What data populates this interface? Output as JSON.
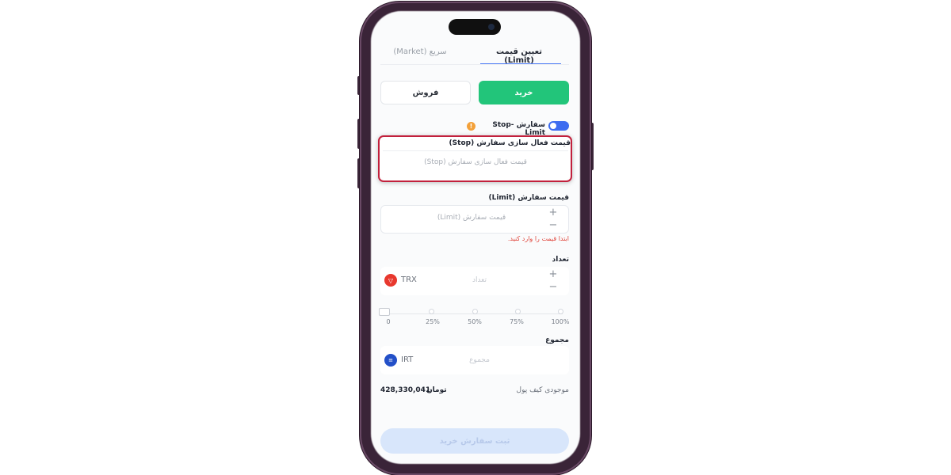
{
  "tabs": {
    "limit_label": "تعیین قیمت (Limit)",
    "market_label": "سریع (Market)"
  },
  "actions": {
    "buy_label": "خرید",
    "sell_label": "فروش"
  },
  "stop_limit": {
    "label": "سفارش Stop-Limit",
    "enabled": true,
    "info_icon": "info-icon"
  },
  "stop_price": {
    "label": "قیمت فعال سازی سفارش (Stop)",
    "placeholder": "(Stop) قیمت فعال سازی سفارش"
  },
  "limit_price": {
    "label": "قیمت سفارش (Limit)",
    "placeholder": "قیمت سفارش (Limit)",
    "error": "ابتدا قیمت را وارد کنید."
  },
  "quantity": {
    "label": "تعداد",
    "placeholder": "تعداد",
    "coin": "TRX"
  },
  "slider": {
    "ticks": [
      "0",
      "25%",
      "50%",
      "75%",
      "100%"
    ],
    "value_percent": 0
  },
  "total": {
    "label": "مجموع",
    "placeholder": "مجموع",
    "coin": "IRT"
  },
  "balance": {
    "label": "موجودی کیف پول",
    "value": "428,330,041",
    "unit": "تومان"
  },
  "submit": {
    "label": "ثبت سفارش خرید"
  },
  "colors": {
    "accent_blue": "#4f7cf5",
    "buy_green": "#22c57a",
    "highlight_red": "#c2203c",
    "error_red": "#e0443a"
  }
}
